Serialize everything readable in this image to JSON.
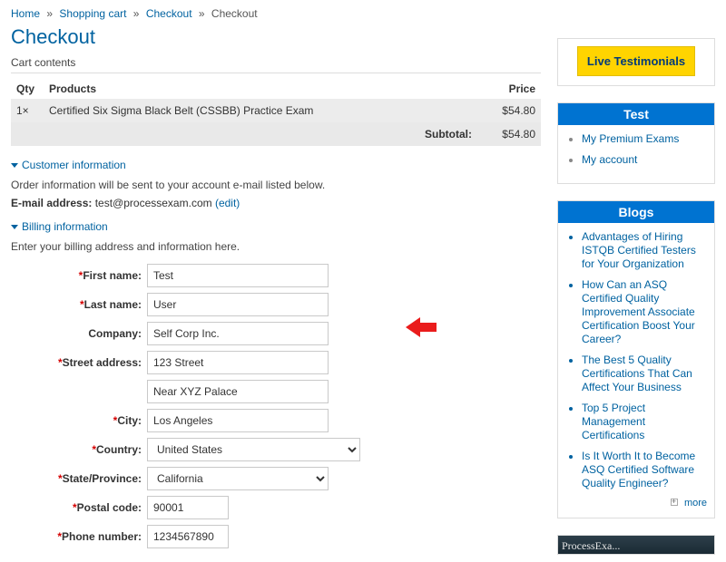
{
  "breadcrumb": {
    "home": "Home",
    "cart": "Shopping cart",
    "checkout1": "Checkout",
    "checkout2": "Checkout"
  },
  "page_title": "Checkout",
  "cart": {
    "contents_label": "Cart contents",
    "headers": {
      "qty": "Qty",
      "products": "Products",
      "price": "Price"
    },
    "line": {
      "qty": "1×",
      "name": "Certified Six Sigma Black Belt (CSSBB) Practice Exam",
      "price": "$54.80"
    },
    "subtotal_label": "Subtotal:",
    "subtotal_value": "$54.80"
  },
  "customer_section": {
    "title": "Customer information",
    "helper": "Order information will be sent to your account e-mail listed below.",
    "email_label": "E-mail address:",
    "email_value": "test@processexam.com",
    "edit_label": "(edit)"
  },
  "billing_section": {
    "title": "Billing information",
    "helper": "Enter your billing address and information here.",
    "labels": {
      "first_name": "First name:",
      "last_name": "Last name:",
      "company": "Company:",
      "street": "Street address:",
      "city": "City:",
      "country": "Country:",
      "state": "State/Province:",
      "postal": "Postal code:",
      "phone": "Phone number:"
    },
    "values": {
      "first_name": "Test",
      "last_name": "User",
      "company": "Self Corp Inc.",
      "street1": "123 Street",
      "street2": "Near XYZ Palace",
      "city": "Los Angeles",
      "country": "United States",
      "state": "California",
      "postal": "90001",
      "phone": "1234567890"
    }
  },
  "sidebar": {
    "live_testimonials": "Live Testimonials",
    "test_heading": "Test",
    "test_links": {
      "premium": "My Premium Exams",
      "account": "My account"
    },
    "blogs_heading": "Blogs",
    "blogs": [
      "Advantages of Hiring ISTQB Certified Testers for Your Organization",
      "How Can an ASQ Certified Quality Improvement Associate Certification Boost Your Career?",
      "The Best 5 Quality Certifications That Can Affect Your Business",
      "Top 5 Project Management Certifications",
      "Is It Worth It to Become ASQ Certified Software Quality Engineer?"
    ],
    "more_label": "more",
    "bottom_widget_text": "ProcessExa..."
  }
}
